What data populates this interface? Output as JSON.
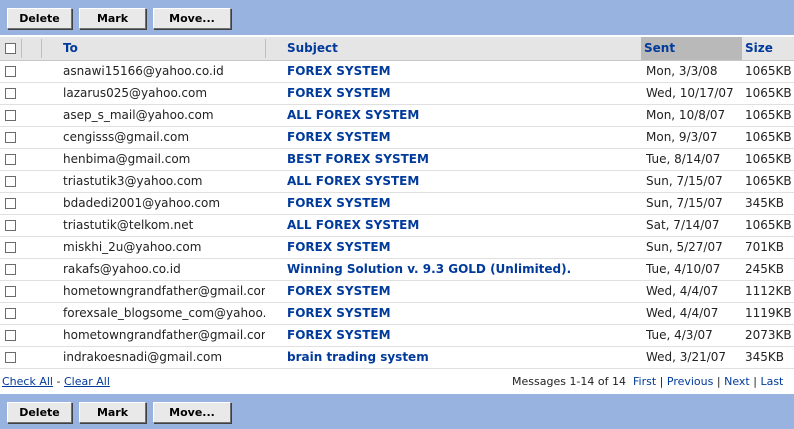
{
  "toolbar": {
    "delete_label": "Delete",
    "mark_label": "Mark",
    "move_label": "Move..."
  },
  "columns": {
    "to": "To",
    "subject": "Subject",
    "sent": "Sent",
    "size": "Size"
  },
  "messages": [
    {
      "to": "asnawi15166@yahoo.co.id",
      "subject": "FOREX SYSTEM",
      "sent": "Mon, 3/3/08",
      "size": "1065KB"
    },
    {
      "to": "lazarus025@yahoo.com",
      "subject": "FOREX SYSTEM",
      "sent": "Wed, 10/17/07",
      "size": "1065KB"
    },
    {
      "to": "asep_s_mail@yahoo.com",
      "subject": "ALL FOREX SYSTEM",
      "sent": "Mon, 10/8/07",
      "size": "1065KB"
    },
    {
      "to": "cengisss@gmail.com",
      "subject": "FOREX SYSTEM",
      "sent": "Mon, 9/3/07",
      "size": "1065KB"
    },
    {
      "to": "henbima@gmail.com",
      "subject": "BEST FOREX SYSTEM",
      "sent": "Tue, 8/14/07",
      "size": "1065KB"
    },
    {
      "to": "triastutik3@yahoo.com",
      "subject": "ALL FOREX SYSTEM",
      "sent": "Sun, 7/15/07",
      "size": "1065KB"
    },
    {
      "to": "bdadedi2001@yahoo.com",
      "subject": "FOREX SYSTEM",
      "sent": "Sun, 7/15/07",
      "size": "345KB"
    },
    {
      "to": "triastutik@telkom.net",
      "subject": "ALL FOREX SYSTEM",
      "sent": "Sat, 7/14/07",
      "size": "1065KB"
    },
    {
      "to": "miskhi_2u@yahoo.com",
      "subject": "FOREX SYSTEM",
      "sent": "Sun, 5/27/07",
      "size": "701KB"
    },
    {
      "to": "rakafs@yahoo.co.id",
      "subject": "Winning Solution v. 9.3 GOLD (Unlimited).",
      "sent": "Tue, 4/10/07",
      "size": "245KB"
    },
    {
      "to": "hometowngrandfather@gmail.com",
      "subject": "FOREX SYSTEM",
      "sent": "Wed, 4/4/07",
      "size": "1112KB"
    },
    {
      "to": "forexsale_blogsome_com@yahoo.com",
      "subject": "FOREX SYSTEM",
      "sent": "Wed, 4/4/07",
      "size": "1119KB"
    },
    {
      "to": "hometowngrandfather@gmail.com",
      "subject": "FOREX SYSTEM",
      "sent": "Tue, 4/3/07",
      "size": "2073KB"
    },
    {
      "to": "indrakoesnadi@gmail.com",
      "subject": "brain trading system",
      "sent": "Wed, 3/21/07",
      "size": "345KB"
    }
  ],
  "footer": {
    "check_all": "Check All",
    "separator": "-",
    "clear_all": "Clear All",
    "messages_count": "Messages 1-14 of 14",
    "first": "First",
    "previous": "Previous",
    "next": "Next",
    "last": "Last",
    "pipe": "|"
  }
}
